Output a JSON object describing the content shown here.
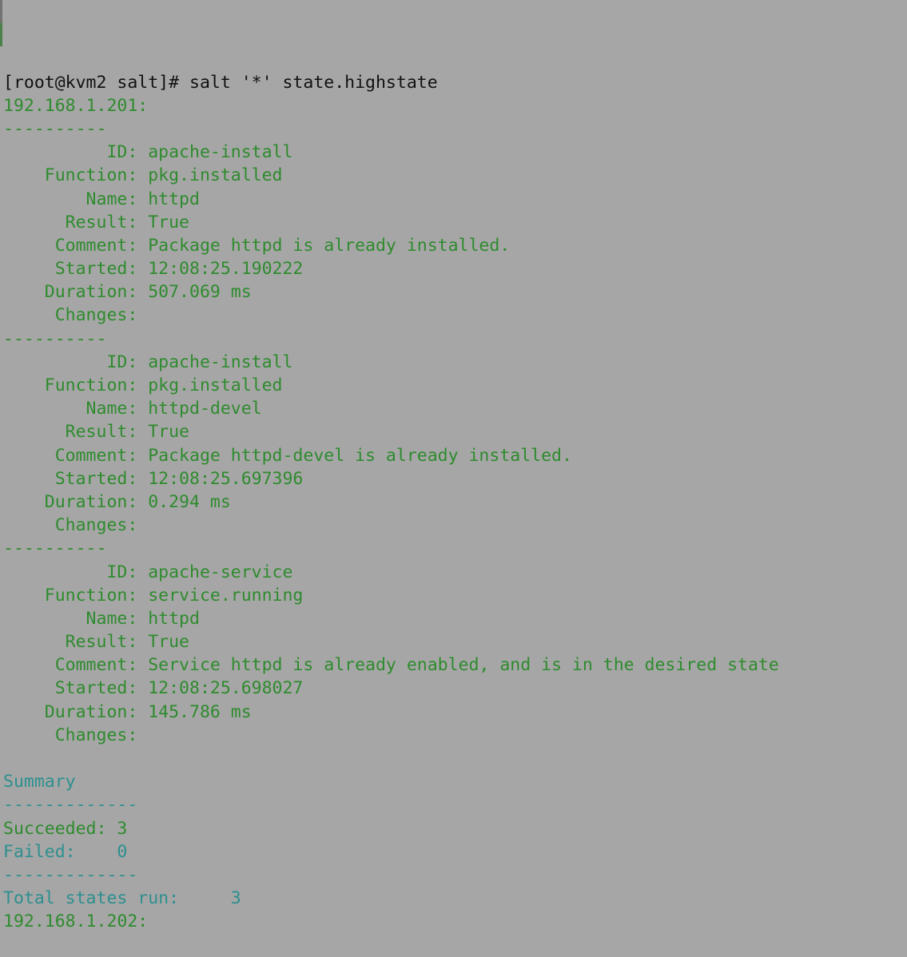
{
  "terminal": {
    "title": "salt state.highstate output",
    "background_color": "#a6a6a6",
    "prompt_color": "#111111",
    "green_color": "#2e8b2e",
    "teal_color": "#2d8f8f",
    "font_size_px": 21.5,
    "line_height_px": 29.2,
    "columns": 74,
    "rows": 37
  },
  "command_line": {
    "prompt": "[root@kvm2 salt]# ",
    "command": "salt '*' state.highstate",
    "full": "[root@kvm2 salt]# salt '*' state.highstate"
  },
  "minion_header": "192.168.1.201:",
  "minion_footer": "192.168.1.202:",
  "separator_short": "----------",
  "separator_summary": "-------------",
  "labels": {
    "id": "          ID: ",
    "function": "    Function: ",
    "name": "        Name: ",
    "result": "      Result: ",
    "comment": "     Comment: ",
    "started": "     Started: ",
    "duration": "    Duration: ",
    "changes": "     Changes:"
  },
  "states": [
    {
      "id": "apache-install",
      "function": "pkg.installed",
      "name": "httpd",
      "result": "True",
      "comment": "Package httpd is already installed.",
      "started": "12:08:25.190222",
      "duration": "507.069 ms",
      "changes": ""
    },
    {
      "id": "apache-install",
      "function": "pkg.installed",
      "name": "httpd-devel",
      "result": "True",
      "comment": "Package httpd-devel is already installed.",
      "started": "12:08:25.697396",
      "duration": "0.294 ms",
      "changes": ""
    },
    {
      "id": "apache-service",
      "function": "service.running",
      "name": "httpd",
      "result": "True",
      "comment": "Service httpd is already enabled, and is in the desired state",
      "started": "12:08:25.698027",
      "duration": "145.786 ms",
      "changes": ""
    }
  ],
  "summary": {
    "heading": "Summary",
    "succeeded_label": "Succeeded: ",
    "succeeded_value": "3",
    "failed_label": "Failed:    ",
    "failed_value": "0",
    "total_label": "Total states run:     ",
    "total_value": "3"
  },
  "rendered_lines": [
    {
      "id": "line-command",
      "text": "[root@kvm2 salt]# salt '*' state.highstate",
      "color": "prompt"
    },
    {
      "id": "line-minion-201",
      "text": "192.168.1.201:",
      "color": "green"
    },
    {
      "id": "line-sep-1",
      "text": "----------",
      "color": "green"
    },
    {
      "id": "line-s1-id",
      "text": "          ID: apache-install",
      "color": "green"
    },
    {
      "id": "line-s1-function",
      "text": "    Function: pkg.installed",
      "color": "green"
    },
    {
      "id": "line-s1-name",
      "text": "        Name: httpd",
      "color": "green"
    },
    {
      "id": "line-s1-result",
      "text": "      Result: True",
      "color": "green"
    },
    {
      "id": "line-s1-comment",
      "text": "     Comment: Package httpd is already installed.",
      "color": "green"
    },
    {
      "id": "line-s1-started",
      "text": "     Started: 12:08:25.190222",
      "color": "green"
    },
    {
      "id": "line-s1-duration",
      "text": "    Duration: 507.069 ms",
      "color": "green"
    },
    {
      "id": "line-s1-changes",
      "text": "     Changes:",
      "color": "green"
    },
    {
      "id": "line-sep-2",
      "text": "----------",
      "color": "green"
    },
    {
      "id": "line-s2-id",
      "text": "          ID: apache-install",
      "color": "green"
    },
    {
      "id": "line-s2-function",
      "text": "    Function: pkg.installed",
      "color": "green"
    },
    {
      "id": "line-s2-name",
      "text": "        Name: httpd-devel",
      "color": "green"
    },
    {
      "id": "line-s2-result",
      "text": "      Result: True",
      "color": "green"
    },
    {
      "id": "line-s2-comment",
      "text": "     Comment: Package httpd-devel is already installed.",
      "color": "green"
    },
    {
      "id": "line-s2-started",
      "text": "     Started: 12:08:25.697396",
      "color": "green"
    },
    {
      "id": "line-s2-duration",
      "text": "    Duration: 0.294 ms",
      "color": "green"
    },
    {
      "id": "line-s2-changes",
      "text": "     Changes:",
      "color": "green"
    },
    {
      "id": "line-sep-3",
      "text": "----------",
      "color": "green"
    },
    {
      "id": "line-s3-id",
      "text": "          ID: apache-service",
      "color": "green"
    },
    {
      "id": "line-s3-function",
      "text": "    Function: service.running",
      "color": "green"
    },
    {
      "id": "line-s3-name",
      "text": "        Name: httpd",
      "color": "green"
    },
    {
      "id": "line-s3-result",
      "text": "      Result: True",
      "color": "green"
    },
    {
      "id": "line-s3-comment",
      "text": "     Comment: Service httpd is already enabled, and is in the desired state",
      "color": "green"
    },
    {
      "id": "line-s3-started",
      "text": "     Started: 12:08:25.698027",
      "color": "green"
    },
    {
      "id": "line-s3-duration",
      "text": "    Duration: 145.786 ms",
      "color": "green"
    },
    {
      "id": "line-s3-changes",
      "text": "     Changes:",
      "color": "green"
    },
    {
      "id": "line-blank-1",
      "text": " ",
      "color": "blank"
    },
    {
      "id": "line-summary-head",
      "text": "Summary",
      "color": "teal"
    },
    {
      "id": "line-summary-sep-1",
      "text": "-------------",
      "color": "teal"
    },
    {
      "id": "line-succeeded",
      "text": "Succeeded: 3",
      "color": "green"
    },
    {
      "id": "line-failed",
      "text": "Failed:    0",
      "color": "teal"
    },
    {
      "id": "line-summary-sep-2",
      "text": "-------------",
      "color": "teal"
    },
    {
      "id": "line-total",
      "text": "Total states run:     3",
      "color": "teal"
    },
    {
      "id": "line-minion-202",
      "text": "192.168.1.202:",
      "color": "green"
    }
  ]
}
